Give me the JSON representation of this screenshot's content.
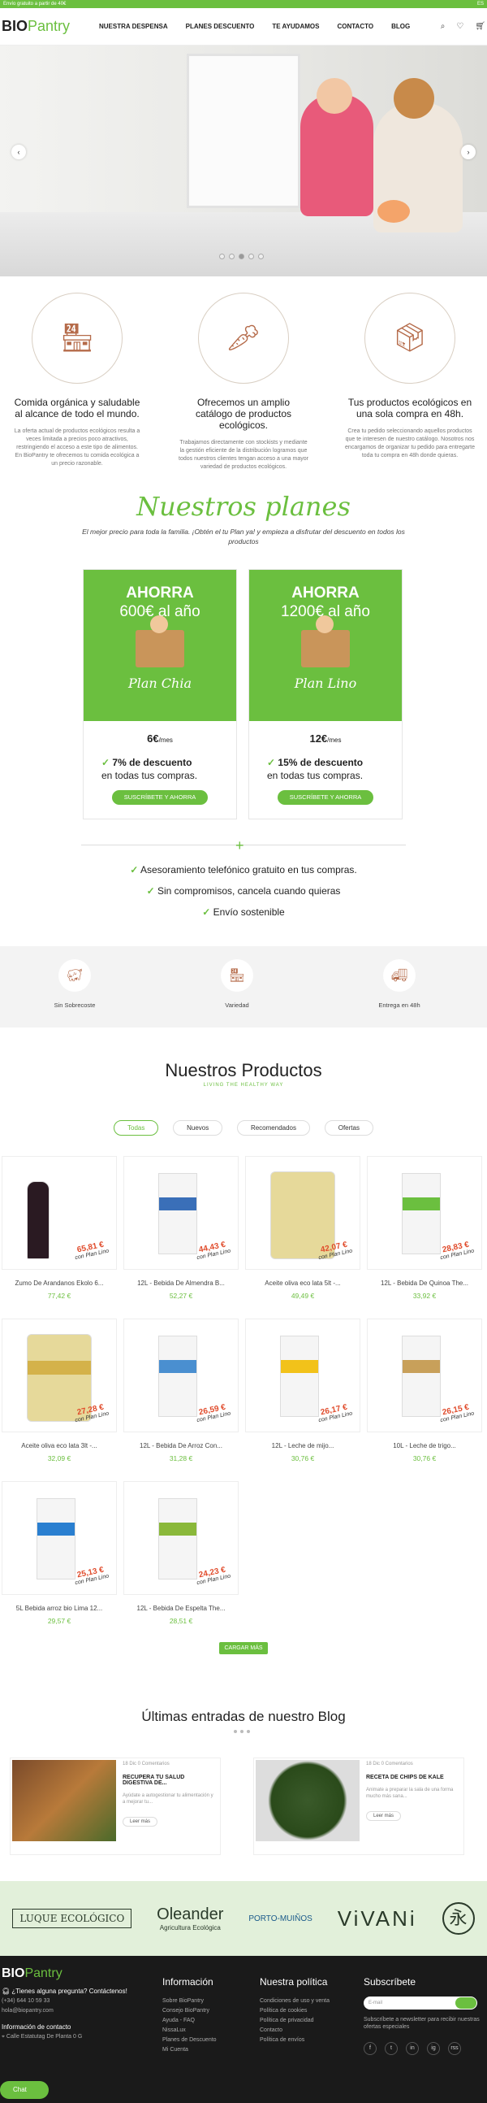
{
  "topbar": {
    "left": "Envío gratuito a partir de 40€",
    "right": "ES"
  },
  "header": {
    "logo_bold": "BIO",
    "logo_light": "Pantry",
    "nav": [
      "NUESTRA DESPENSA",
      "PLANES DESCUENTO",
      "TE AYUDAMOS",
      "CONTACTO",
      "BLOG"
    ],
    "icons": [
      "search-icon",
      "heart-icon",
      "cart-icon"
    ]
  },
  "hero": {
    "prev": "‹",
    "next": "›"
  },
  "features": [
    {
      "title": "Comida orgánica y saludable al alcance de todo el mundo.",
      "text": "La oferta actual de productos ecológicos resulta a veces limitada a precios poco atractivos, restringiendo el acceso a este tipo de alimentos. En BioPantry te ofrecemos tu comida ecológica a un precio razonable."
    },
    {
      "title": "Ofrecemos un amplio catálogo de productos ecológicos.",
      "text": "Trabajamos directamente con stockists y mediante la gestión eficiente de la distribución logramos que todos nuestros clientes tengan acceso a una mayor variedad de productos ecológicos."
    },
    {
      "title": "Tus productos ecológicos en una sola compra en 48h.",
      "text": "Crea tu pedido seleccionando aquellos productos que te interesen de nuestro catálogo. Nosotros nos encargamos de organizar tu pedido para entregarte toda tu compra en 48h donde quieras."
    }
  ],
  "planes": {
    "title": "Nuestros planes",
    "subtitle": "El mejor precio para toda la familia. ¡Obtén el tu Plan ya! y empieza a disfrutar del descuento en todos los productos",
    "cards": [
      {
        "ahorra": "AHORRA",
        "amount": "600€ al año",
        "name": "Plan Chia",
        "price": "6€",
        "per": "/mes",
        "disc1": "7% de descuento",
        "disc2": "en todas tus compras.",
        "button": "SUSCRÍBETE Y AHORRA"
      },
      {
        "ahorra": "AHORRA",
        "amount": "1200€ al año",
        "name": "Plan Lino",
        "price": "12€",
        "per": "/mes",
        "disc1": "15% de descuento",
        "disc2": "en todas tus compras.",
        "button": "SUSCRÍBETE Y AHORRA"
      }
    ],
    "plus": "+",
    "benefits": [
      "Asesoramiento telefónico gratuito en tus compras.",
      "Sin compromisos, cancela cuando quieras",
      "Envío sostenible"
    ]
  },
  "services": [
    "Sin Sobrecoste",
    "Variedad",
    "Entrega en 48h"
  ],
  "productos": {
    "title": "Nuestros Productos",
    "subtitle": "LIVING THE HEALTHY WAY",
    "tabs": [
      "Todas",
      "Nuevos",
      "Recomendados",
      "Ofertas"
    ],
    "plan_label": "con Plan Lino",
    "items": [
      {
        "name": "Zumo De Arandanos Ekolo 6...",
        "price": "77,42 €",
        "plan_price": "65,81 €",
        "kind": "bot",
        "color": "#2a1a22"
      },
      {
        "name": "12L - Bebida De Almendra B...",
        "price": "52,27 €",
        "plan_price": "44,43 €",
        "kind": "pack",
        "color": "#3a6fb8"
      },
      {
        "name": "Aceite oliva eco lata 5lt -...",
        "price": "49,49 €",
        "plan_price": "42,07 €",
        "kind": "tin",
        "color": "#e6d99a"
      },
      {
        "name": "12L - Bebida De Quinoa The...",
        "price": "33,92 €",
        "plan_price": "28,83 €",
        "kind": "pack",
        "color": "#6bbf3f"
      },
      {
        "name": "Aceite oliva eco lata 3lt -...",
        "price": "32,09 €",
        "plan_price": "27,28 €",
        "kind": "tin",
        "color": "#d4b24a"
      },
      {
        "name": "12L - Bebida De Arroz Con...",
        "price": "31,28 €",
        "plan_price": "26,59 €",
        "kind": "pack",
        "color": "#4a8fd0"
      },
      {
        "name": "12L - Leche de mijo...",
        "price": "30,76 €",
        "plan_price": "26,17 €",
        "kind": "pack",
        "color": "#f2c21a"
      },
      {
        "name": "10L - Leche de trigo...",
        "price": "30,76 €",
        "plan_price": "26,15 €",
        "kind": "pack",
        "color": "#c8a05a"
      },
      {
        "name": "5L Bebida arroz bio Lima 12...",
        "price": "29,57 €",
        "plan_price": "25,13 €",
        "kind": "pack",
        "color": "#2a7fd0"
      },
      {
        "name": "12L - Bebida De Espelta The...",
        "price": "28,51 €",
        "plan_price": "24,23 €",
        "kind": "pack",
        "color": "#8ab83a"
      }
    ],
    "more": "CARGAR MÁS"
  },
  "blog": {
    "title": "Últimas entradas de nuestro Blog",
    "posts": [
      {
        "meta": "18 Dic   0 Comentarios",
        "title": "RECUPERA TU SALUD DIGESTIVA DE...",
        "text": "Ayúdate a autogestionar tu alimentación y a mejorar tu...",
        "more": "Leer más"
      },
      {
        "meta": "18 Dic   0 Comentarios",
        "title": "RECETA DE CHIPS DE KALE",
        "text": "Animate a preparar la sala de una forma mucho más sana...",
        "more": "Leer más"
      }
    ]
  },
  "brands": [
    "LUQUE ECOLÓGICO",
    "Oleander",
    "Agricultura Ecológica",
    "PORTO-MUIÑOS",
    "ViVANi",
    "永"
  ],
  "footer": {
    "logo_bold": "BIO",
    "logo_light": "Pantry",
    "question": "¿Tienes alguna pregunta? Contáctenos!",
    "phone": "(+34) 644 10 59 33",
    "email": "hola@biopantry.com",
    "contact_title": "Información de contacto",
    "address": "Calle Estatutag De Planta 0 G",
    "info_title": "Información",
    "info": [
      "Sobre BioPantry",
      "Consejo BioPantry",
      "Ayuda - FAQ",
      "NissaLux",
      "Planes de Descuento",
      "Mi Cuenta"
    ],
    "policy_title": "Nuestra política",
    "policy": [
      "Condiciones de uso y venta",
      "Política de cookies",
      "Política de privacidad",
      "Contacto",
      "Política de envíos"
    ],
    "sub_title": "Subscríbete",
    "sub_placeholder": "E-mail",
    "sub_text": "Subscríbete a newsletter para recibir nuestras ofertas especiales",
    "social": [
      "f",
      "t",
      "in",
      "ig",
      "rss"
    ]
  },
  "chat": "Chat"
}
